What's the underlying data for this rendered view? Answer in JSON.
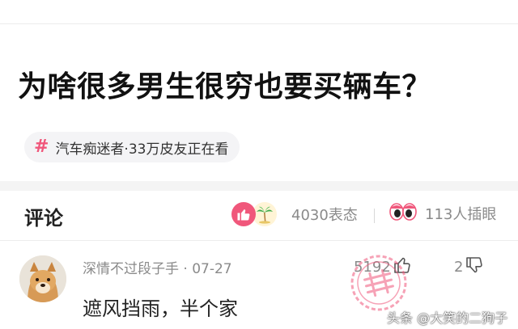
{
  "question": {
    "title": "为啥很多男生很穷也要买辆车？"
  },
  "topic": {
    "icon": "hash-icon",
    "label": "汽车痴迷者·33万皮友正在看"
  },
  "comments_section": {
    "title": "评论",
    "reactions_count": "4030表态",
    "viewers_count": "113人插眼"
  },
  "comment": {
    "user_meta": "深情不过段子手 · 07-27",
    "text": "遮风挡雨，半个家",
    "likes": "5192",
    "dislikes": "2"
  },
  "watermark": {
    "text": "头条 @大笑的二狗子"
  },
  "colors": {
    "accent": "#f0577b",
    "muted_text": "#8a8a8a"
  }
}
